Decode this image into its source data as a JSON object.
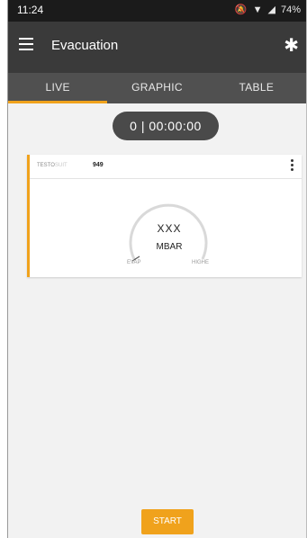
{
  "statusbar": {
    "time": "11:24",
    "battery": "74%"
  },
  "appbar": {
    "title": "Evacuation"
  },
  "tabs": [
    {
      "label": "LIVE",
      "active": true
    },
    {
      "label": "GRAPHIC",
      "active": false
    },
    {
      "label": "TABLE",
      "active": false
    }
  ],
  "timer": "0 | 00:00:00",
  "card": {
    "brand": "TESTO",
    "device": "SUIT",
    "model": "949",
    "value": "XXX",
    "unit": "MBAR",
    "min_label": "EVAP",
    "max_label": "HIGHE"
  },
  "actions": {
    "start_label": "START"
  },
  "colors": {
    "accent": "#f0a21c",
    "appbar": "#3a3a3a",
    "tabs": "#505050"
  }
}
